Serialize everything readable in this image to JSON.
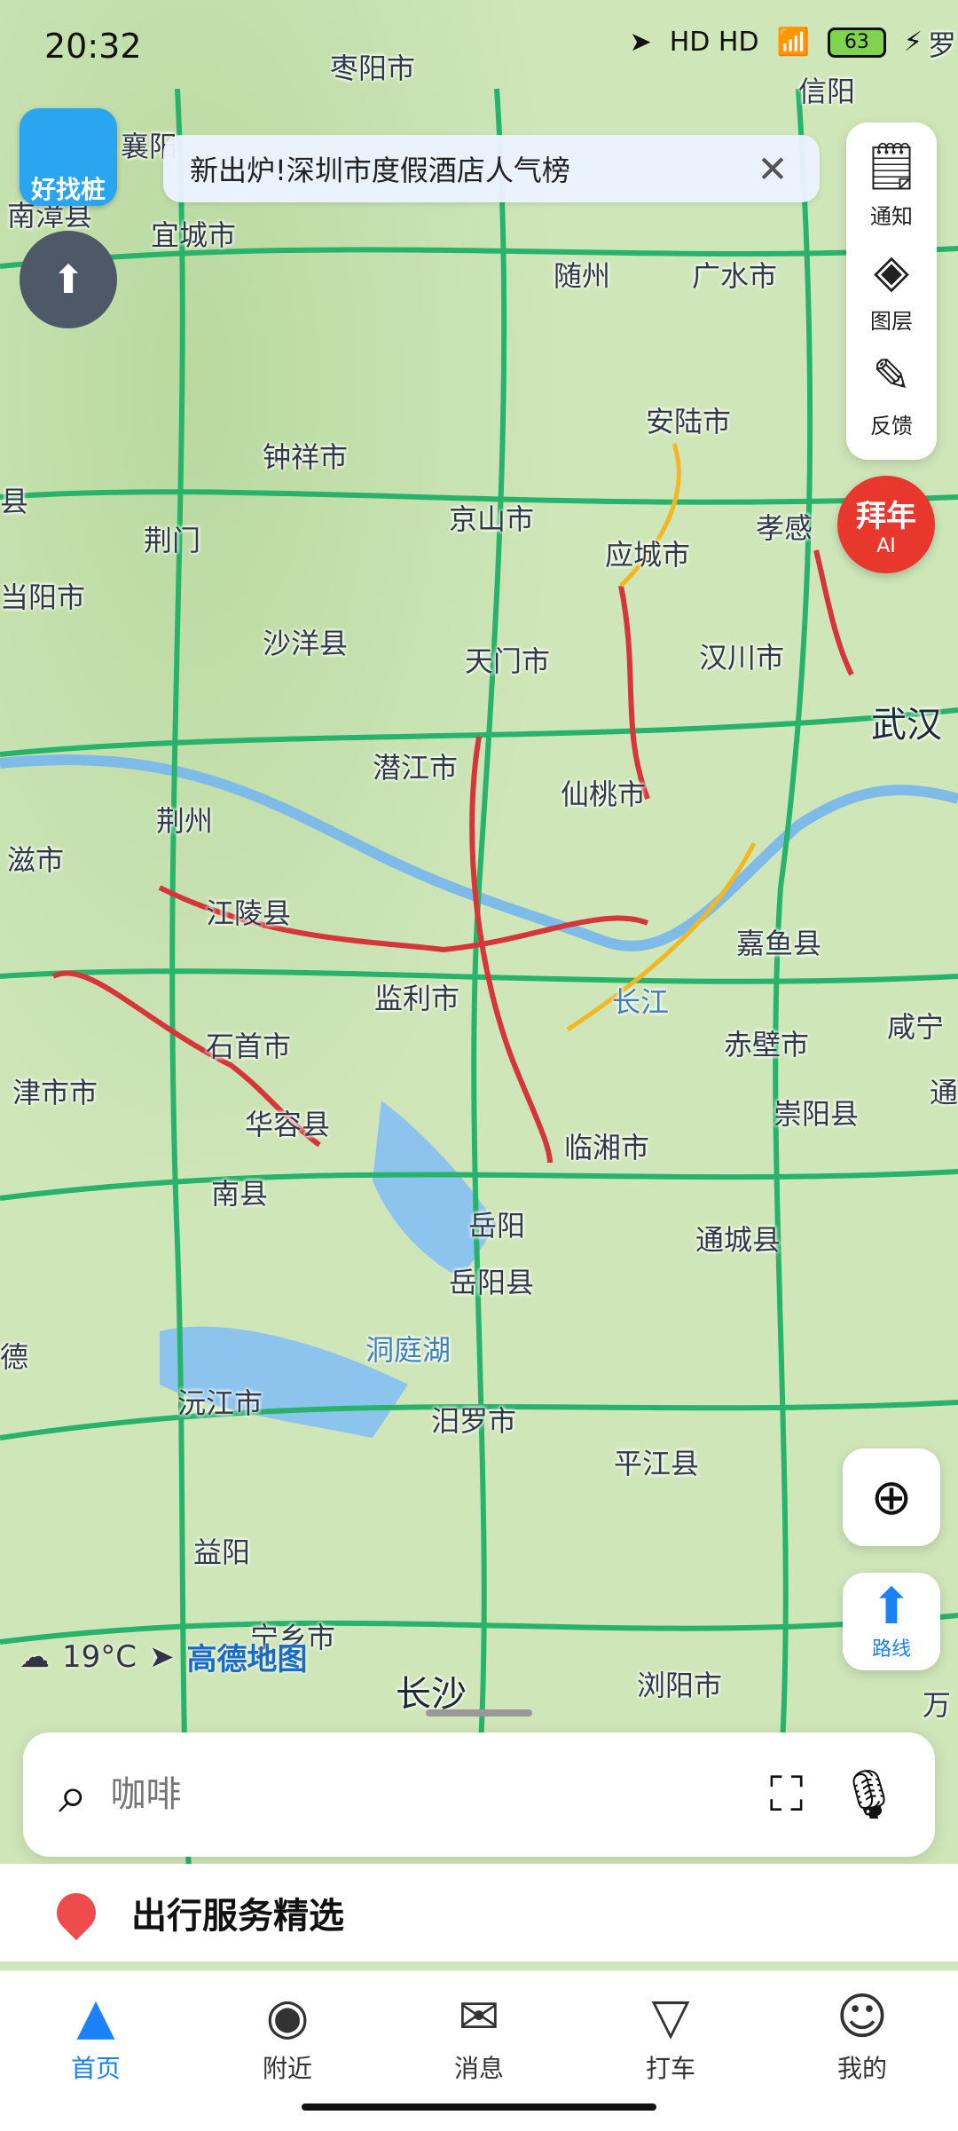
{
  "status": {
    "time": "20:32",
    "signal_icons": "HD HD",
    "battery": "63"
  },
  "banner": {
    "text": "新出炉!深圳市度假酒店人气榜",
    "close_icon": "close-icon"
  },
  "app_badge": {
    "label": "好找桩"
  },
  "toolbar": {
    "items": [
      {
        "label": "通知",
        "icon": "notice-icon"
      },
      {
        "label": "图层",
        "icon": "layers-icon"
      },
      {
        "label": "反馈",
        "icon": "feedback-icon"
      }
    ]
  },
  "ai_badge": {
    "title": "拜年",
    "sub": "AI"
  },
  "map": {
    "places": [
      {
        "name": "枣阳市",
        "type": "city"
      },
      {
        "name": "信阳",
        "type": "city"
      },
      {
        "name": "襄阳",
        "type": "city"
      },
      {
        "name": "南漳县",
        "type": "city"
      },
      {
        "name": "宜城市",
        "type": "city"
      },
      {
        "name": "随州",
        "type": "city"
      },
      {
        "name": "广水市",
        "type": "city"
      },
      {
        "name": "安陆市",
        "type": "city"
      },
      {
        "name": "钟祥市",
        "type": "city"
      },
      {
        "name": "京山市",
        "type": "city"
      },
      {
        "name": "孝感",
        "type": "city"
      },
      {
        "name": "应城市",
        "type": "city"
      },
      {
        "name": "荆门",
        "type": "city"
      },
      {
        "name": "当阳市",
        "type": "city"
      },
      {
        "name": "县",
        "type": "city"
      },
      {
        "name": "沙洋县",
        "type": "city"
      },
      {
        "name": "天门市",
        "type": "city"
      },
      {
        "name": "汉川市",
        "type": "city"
      },
      {
        "name": "武汉",
        "type": "city"
      },
      {
        "name": "潜江市",
        "type": "city"
      },
      {
        "name": "仙桃市",
        "type": "city"
      },
      {
        "name": "荆州",
        "type": "city"
      },
      {
        "name": "滋市",
        "type": "city"
      },
      {
        "name": "江陵县",
        "type": "city"
      },
      {
        "name": "嘉鱼县",
        "type": "city"
      },
      {
        "name": "监利市",
        "type": "city"
      },
      {
        "name": "长江",
        "type": "water"
      },
      {
        "name": "咸宁",
        "type": "city"
      },
      {
        "name": "石首市",
        "type": "city"
      },
      {
        "name": "赤壁市",
        "type": "city"
      },
      {
        "name": "津市市",
        "type": "city"
      },
      {
        "name": "华容县",
        "type": "city"
      },
      {
        "name": "崇阳县",
        "type": "city"
      },
      {
        "name": "临湘市",
        "type": "city"
      },
      {
        "name": "南县",
        "type": "city"
      },
      {
        "name": "岳阳",
        "type": "city"
      },
      {
        "name": "通城县",
        "type": "city"
      },
      {
        "name": "岳阳县",
        "type": "city"
      },
      {
        "name": "德",
        "type": "city"
      },
      {
        "name": "洞庭湖",
        "type": "water"
      },
      {
        "name": "沅江市",
        "type": "city"
      },
      {
        "name": "汨罗市",
        "type": "city"
      },
      {
        "name": "平江县",
        "type": "city"
      },
      {
        "name": "益阳",
        "type": "city"
      },
      {
        "name": "宁乡市",
        "type": "city"
      },
      {
        "name": "长沙",
        "type": "city"
      },
      {
        "name": "浏阳市",
        "type": "city"
      },
      {
        "name": "罗",
        "type": "city"
      },
      {
        "name": "通",
        "type": "city"
      },
      {
        "name": "万",
        "type": "city"
      }
    ]
  },
  "weather": {
    "temp": "19°C",
    "brand": "高德地图"
  },
  "search": {
    "placeholder": "咖啡",
    "scan_icon": "scan-icon",
    "mic_icon": "mic-icon"
  },
  "service": {
    "title": "出行服务精选"
  },
  "nav": {
    "tabs": [
      {
        "label": "首页",
        "icon": "home-icon",
        "active": true
      },
      {
        "label": "附近",
        "icon": "nearby-icon",
        "active": false
      },
      {
        "label": "消息",
        "icon": "message-icon",
        "active": false
      },
      {
        "label": "打车",
        "icon": "taxi-icon",
        "active": false
      },
      {
        "label": "我的",
        "icon": "profile-icon",
        "active": false
      }
    ]
  }
}
